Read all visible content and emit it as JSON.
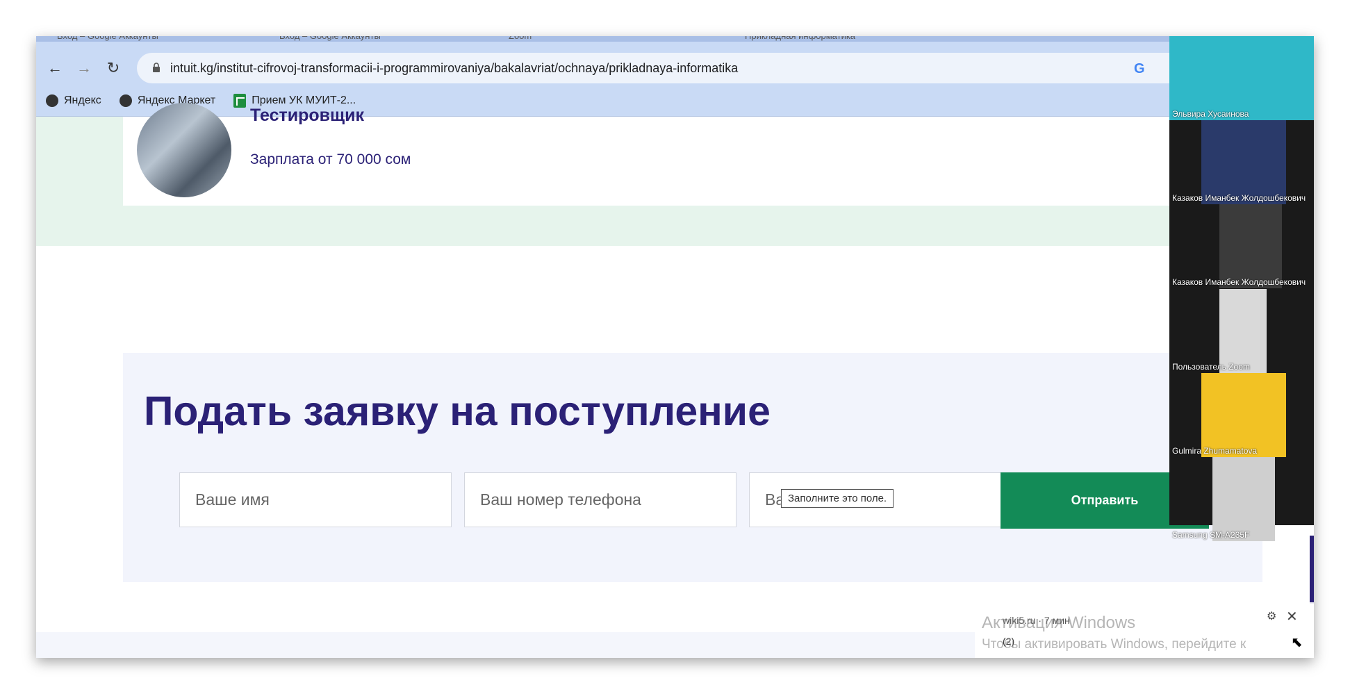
{
  "browser": {
    "tabs": [
      "Вход – Google Аккаунты",
      "Вход – Google Аккаунты",
      "Zoom",
      "Прикладная информатика"
    ],
    "url": "intuit.kg/institut-cifrovoj-transformacii-i-programmirovaniya/bakalavriat/ochnaya/prikladnaya-informatika",
    "bookmarks": [
      "Яндекс",
      "Яндекс Маркет",
      "Прием УК МУИТ-2..."
    ]
  },
  "job": {
    "title": "Тестировщик",
    "salary": "Зарплата от 70 000 сом"
  },
  "form": {
    "title": "Подать заявку на поступление",
    "name_placeholder": "Ваше имя",
    "phone_placeholder": "Ваш номер телефона",
    "email_placeholder": "Ваш e-mail",
    "submit_label": "Отправить",
    "tooltip": "Заполните это поле."
  },
  "participants": [
    {
      "name": "Эльвира Хусаинова",
      "color": "#2fb8c8"
    },
    {
      "name": "Казаков Иманбек Жолдошбекович",
      "color": "#2a3a6a"
    },
    {
      "name": "Казаков Иманбек Жолдошбекович",
      "color": "#3b3b3b"
    },
    {
      "name": "Пользователь Zoom",
      "color": "#d9d9d9"
    },
    {
      "name": "Gulmira Zhumamatova",
      "color": "#f2c224"
    },
    {
      "name": "Samsung SM-A235F",
      "color": "#cfcfcf"
    }
  ],
  "notification": {
    "source": "wiki5.ru · 7 мин",
    "count": "(2)"
  },
  "watermark": {
    "line1": "Активация Windows",
    "line2": "Чтобы активировать Windows, перейдите к"
  }
}
